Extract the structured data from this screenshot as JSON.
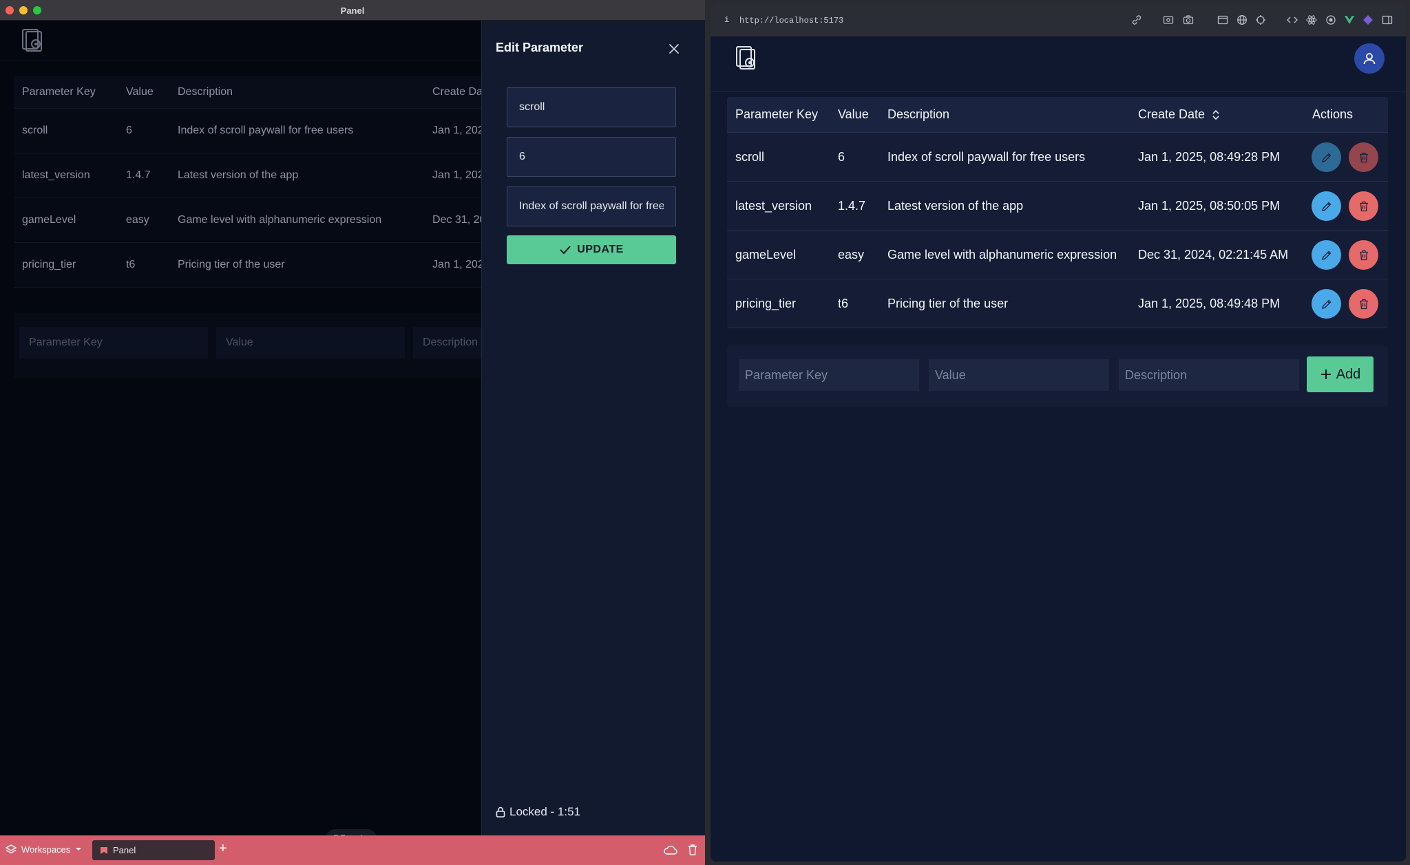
{
  "left_window": {
    "title": "Panel",
    "table": {
      "headers": [
        "Parameter Key",
        "Value",
        "Description",
        "Create Da"
      ],
      "rows": [
        {
          "key": "scroll",
          "value": "6",
          "description": "Index of scroll paywall for free users",
          "date": "Jan 1, 202"
        },
        {
          "key": "latest_version",
          "value": "1.4.7",
          "description": "Latest version of the app",
          "date": "Jan 1, 202"
        },
        {
          "key": "gameLevel",
          "value": "easy",
          "description": "Game level with alphanumeric expression",
          "date": "Dec 31, 20"
        },
        {
          "key": "pricing_tier",
          "value": "t6",
          "description": "Pricing tier of the user",
          "date": "Jan 1, 202"
        }
      ]
    },
    "add_form": {
      "key_placeholder": "Parameter Key",
      "value_placeholder": "Value",
      "desc_placeholder": "Description"
    },
    "drawer": {
      "title": "Edit Parameter",
      "key_value": "scroll",
      "value_value": "6",
      "desc_value": "Index of scroll paywall for free users",
      "update_label": "UPDATE",
      "locked_text": "Locked - 1:51"
    },
    "taskbar": {
      "workspaces_label": "Workspaces",
      "tab_label": "Panel",
      "plus": "+"
    }
  },
  "right_window": {
    "url": "http://localhost:5173",
    "info_glyph": "i",
    "table": {
      "headers": {
        "key": "Parameter Key",
        "value": "Value",
        "description": "Description",
        "date": "Create Date",
        "actions": "Actions"
      },
      "rows": [
        {
          "key": "scroll",
          "value": "6",
          "description": "Index of scroll paywall for free users",
          "date": "Jan 1, 2025, 08:49:28 PM"
        },
        {
          "key": "latest_version",
          "value": "1.4.7",
          "description": "Latest version of the app",
          "date": "Jan 1, 2025, 08:50:05 PM"
        },
        {
          "key": "gameLevel",
          "value": "easy",
          "description": "Game level with alphanumeric expression",
          "date": "Dec 31, 2024, 02:21:45 AM"
        },
        {
          "key": "pricing_tier",
          "value": "t6",
          "description": "Pricing tier of the user",
          "date": "Jan 1, 2025, 08:49:48 PM"
        }
      ]
    },
    "add_form": {
      "key_placeholder": "Parameter Key",
      "value_placeholder": "Value",
      "desc_placeholder": "Description",
      "add_label": "Add"
    }
  },
  "colors": {
    "accent_green": "#59c995",
    "edit_blue": "#4aa9e8",
    "delete_red": "#e66a6a",
    "taskbar": "#d45d6c",
    "avatar": "#2b4aa8"
  }
}
